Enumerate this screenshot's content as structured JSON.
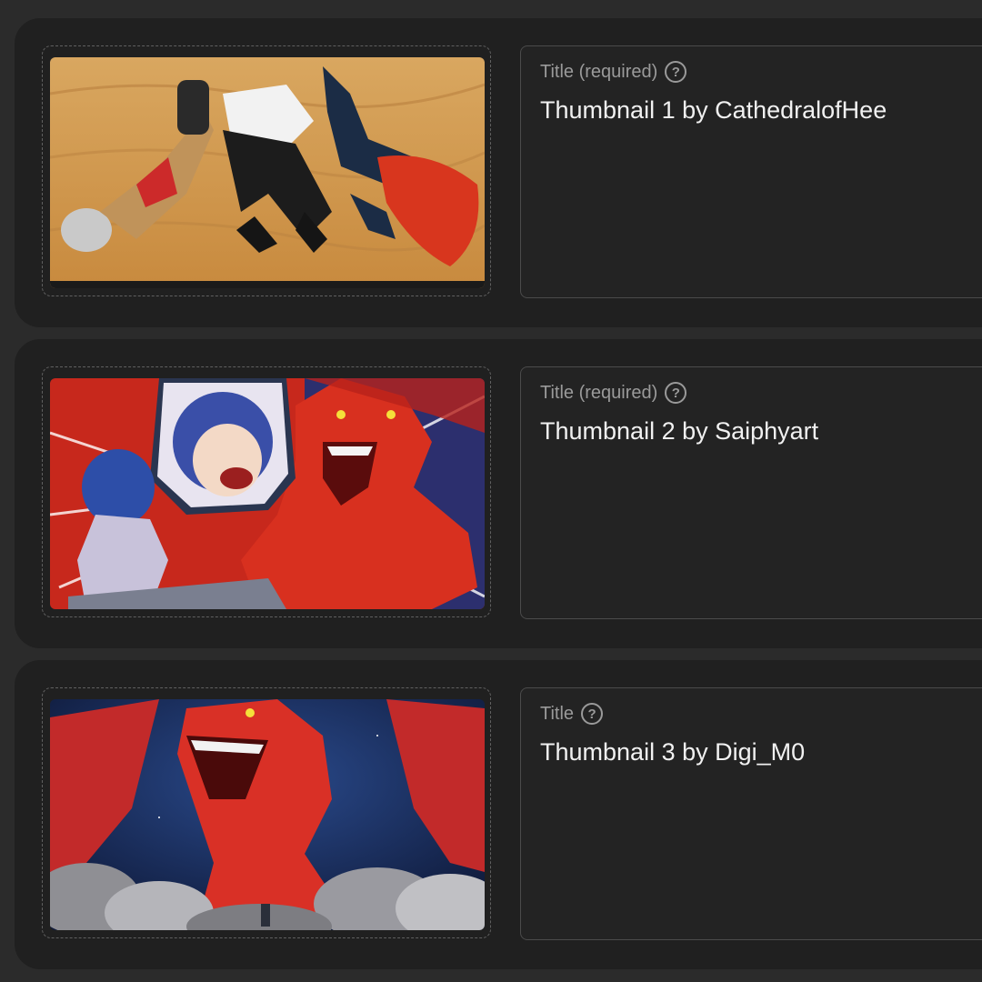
{
  "items": [
    {
      "label": "Title (required)",
      "help_icon": "help-circle-icon",
      "value": "Thumbnail 1 by CathedralofHee",
      "thumbnail": "anime-characters-lying-in-desert-sand"
    },
    {
      "label": "Title (required)",
      "help_icon": "help-circle-icon",
      "value": "Thumbnail 2 by Saiphyart",
      "thumbnail": "blue-haired-girl-shocked-by-red-dragon"
    },
    {
      "label": "Title",
      "help_icon": "help-circle-icon",
      "value": "Thumbnail 3 by Digi_M0",
      "thumbnail": "red-dragon-roaring-over-small-figure-in-smoke"
    }
  ],
  "help_glyph": "?",
  "colors": {
    "background": "#2b2b2b",
    "card": "#202020",
    "field_border": "#4b4b4b",
    "label": "#9a9a9a",
    "value": "#f1f1f1"
  }
}
